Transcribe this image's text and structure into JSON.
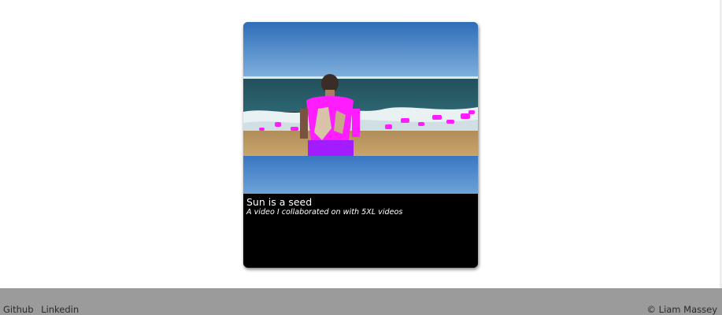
{
  "card": {
    "title": "Sun is a seed",
    "subtitle": "A video I collaborated on with 5XL videos",
    "thumbnail_icon": "video-thumbnail-beach-figure"
  },
  "footer": {
    "links": [
      "Github",
      "Linkedin"
    ],
    "copyright": "© Liam Massey"
  },
  "colors": {
    "footer_bg": "#9b9b9b",
    "card_bg": "#000000",
    "accent_magenta": "#ff1cff",
    "sky": "#3f7fc7",
    "sea": "#1f4a5a"
  }
}
